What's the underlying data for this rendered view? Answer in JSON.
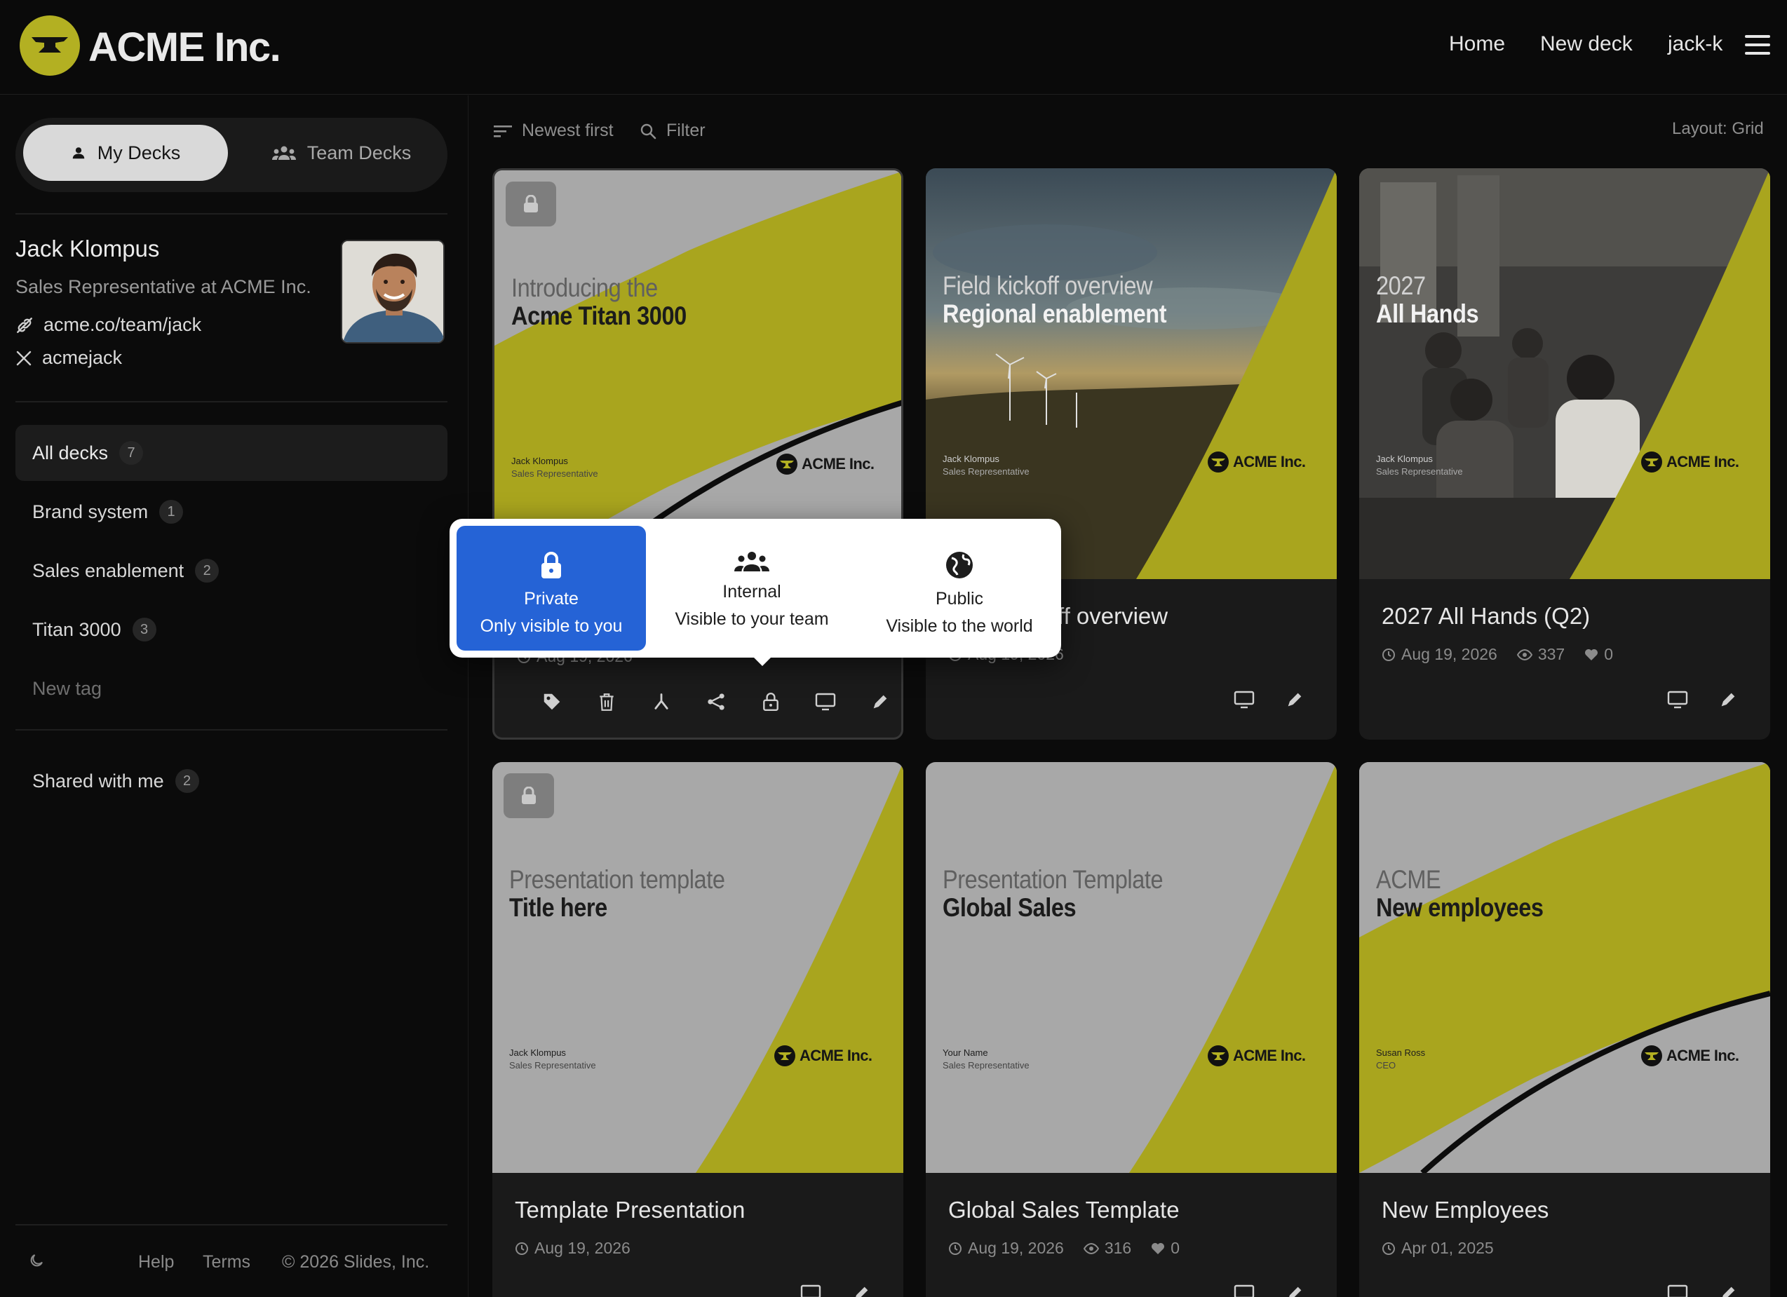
{
  "header": {
    "logo_text": "ACME Inc.",
    "nav": [
      "Home",
      "New deck",
      "jack-k"
    ]
  },
  "sidebar": {
    "tabs": {
      "my": "My Decks",
      "team": "Team Decks"
    },
    "profile": {
      "name": "Jack Klompus",
      "role": "Sales Representative at ACME Inc.",
      "website": "acme.co/team/jack",
      "x_handle": "acmejack"
    },
    "tags": [
      {
        "label": "All decks",
        "count": "7"
      },
      {
        "label": "Brand system",
        "count": "1"
      },
      {
        "label": "Sales enablement",
        "count": "2"
      },
      {
        "label": "Titan 3000",
        "count": "3"
      }
    ],
    "new_tag": "New tag",
    "shared": {
      "label": "Shared with me",
      "count": "2"
    },
    "footer": {
      "help": "Help",
      "terms": "Terms",
      "copyright": "© 2026 Slides, Inc."
    }
  },
  "toolbar": {
    "sort": "Newest first",
    "filter": "Filter",
    "layout": "Layout: Grid"
  },
  "brand_color": "#b3b022",
  "decks": [
    {
      "slide_line1": "Introducing the",
      "slide_line2": "Acme Titan 3000",
      "presenter": "Jack Klompus",
      "presenter_role": "Sales Representative",
      "brand": "ACME Inc.",
      "title": "",
      "date": "Aug 19, 2026",
      "private": true
    },
    {
      "slide_line1": "Field kickoff overview",
      "slide_line2": "Regional enablement",
      "presenter": "Jack Klompus",
      "presenter_role": "Sales Representative",
      "brand": "ACME Inc.",
      "title": "ff overview",
      "date": "Aug 19, 2026",
      "private": false
    },
    {
      "slide_line1": "2027",
      "slide_line2": "All Hands",
      "presenter": "Jack Klompus",
      "presenter_role": "Sales Representative",
      "brand": "ACME Inc.",
      "title": "2027 All Hands (Q2)",
      "date": "Aug 19, 2026",
      "views": "337",
      "likes": "0",
      "private": false
    },
    {
      "slide_line1": "Presentation template",
      "slide_line2": "Title here",
      "presenter": "Jack Klompus",
      "presenter_role": "Sales Representative",
      "brand": "ACME Inc.",
      "title": "Template Presentation",
      "date": "Aug 19, 2026",
      "private": true
    },
    {
      "slide_line1": "Presentation Template",
      "slide_line2": "Global Sales",
      "presenter": "Your Name",
      "presenter_role": "Sales Representative",
      "brand": "ACME Inc.",
      "title": "Global Sales Template",
      "date": "Aug 19, 2026",
      "views": "316",
      "likes": "0",
      "private": false
    },
    {
      "slide_line1": "ACME",
      "slide_line2": "New employees",
      "presenter": "Susan Ross",
      "presenter_role": "CEO",
      "brand": "ACME Inc.",
      "title": "New Employees",
      "date": "Apr 01, 2025",
      "private": false
    }
  ],
  "visibility_popover": {
    "options": [
      {
        "name": "Private",
        "desc": "Only visible to you",
        "icon": "lock-icon",
        "selected": true
      },
      {
        "name": "Internal",
        "desc": "Visible to your team",
        "icon": "team-icon",
        "selected": false
      },
      {
        "name": "Public",
        "desc": "Visible to the world",
        "icon": "globe-icon",
        "selected": false
      }
    ]
  }
}
